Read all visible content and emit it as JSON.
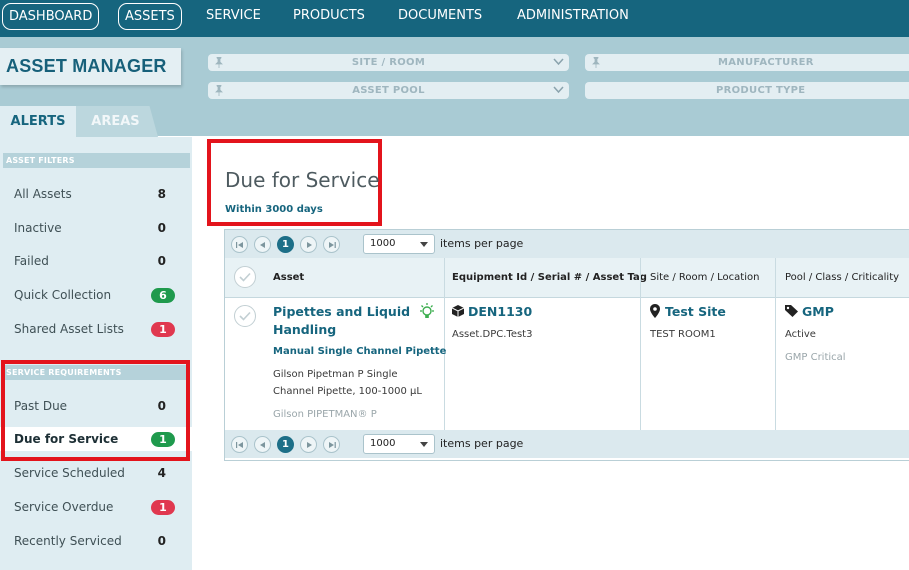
{
  "topnav": {
    "dashboard": "DASHBOARD",
    "assets": "ASSETS",
    "service": "SERVICE",
    "products": "PRODUCTS",
    "documents": "DOCUMENTS",
    "administration": "ADMINISTRATION"
  },
  "app_title": "ASSET MANAGER",
  "filters": {
    "site_room": "SITE / ROOM",
    "manufacturer": "MANUFACTURER",
    "asset_pool": "ASSET POOL",
    "product_type": "PRODUCT TYPE"
  },
  "tabs": {
    "alerts": "ALERTS",
    "areas": "AREAS"
  },
  "sidebar": {
    "asset_filters_heading": "ASSET FILTERS",
    "asset_filters": [
      {
        "label": "All Assets",
        "count": "8"
      },
      {
        "label": "Inactive",
        "count": "0"
      },
      {
        "label": "Failed",
        "count": "0"
      },
      {
        "label": "Quick Collection",
        "count": "6"
      },
      {
        "label": "Shared Asset Lists",
        "count": "1"
      }
    ],
    "service_heading": "SERVICE REQUIREMENTS",
    "service_items": [
      {
        "label": "Past Due",
        "count": "0"
      },
      {
        "label": "Due for Service",
        "count": "1"
      },
      {
        "label": "Service Scheduled",
        "count": "4"
      },
      {
        "label": "Service Overdue",
        "count": "1"
      },
      {
        "label": "Recently Serviced",
        "count": "0"
      }
    ]
  },
  "main": {
    "title": "Due for Service",
    "subtitle": "Within 3000 days"
  },
  "pager": {
    "current_page": "1",
    "page_size": "1000",
    "items_per_page": "items per page"
  },
  "grid": {
    "columns": {
      "asset": "Asset",
      "equipment": "Equipment Id / Serial # / Asset Tag",
      "site": "Site / Room / Location",
      "pool": "Pool / Class / Criticality"
    },
    "row": {
      "asset_name": "Pipettes and Liquid Handling",
      "asset_type": "Manual Single Channel Pipette",
      "asset_desc": "Gilson Pipetman P Single Channel Pipette, 100-1000 µL",
      "asset_mfr": "Gilson PIPETMAN® P",
      "equipment_id": "DEN1130",
      "equipment_tag": "Asset.DPC.Test3",
      "site": "Test Site",
      "room": "TEST ROOM1",
      "pool": "GMP",
      "status": "Active",
      "criticality": "GMP Critical"
    }
  },
  "colors": {
    "nav": "#16657e",
    "band": "#a9cbd4",
    "sidebar": "#dfedf2",
    "highlight_red": "#e3141c",
    "badge_green": "#1f9a4d",
    "badge_red": "#e0384f"
  }
}
